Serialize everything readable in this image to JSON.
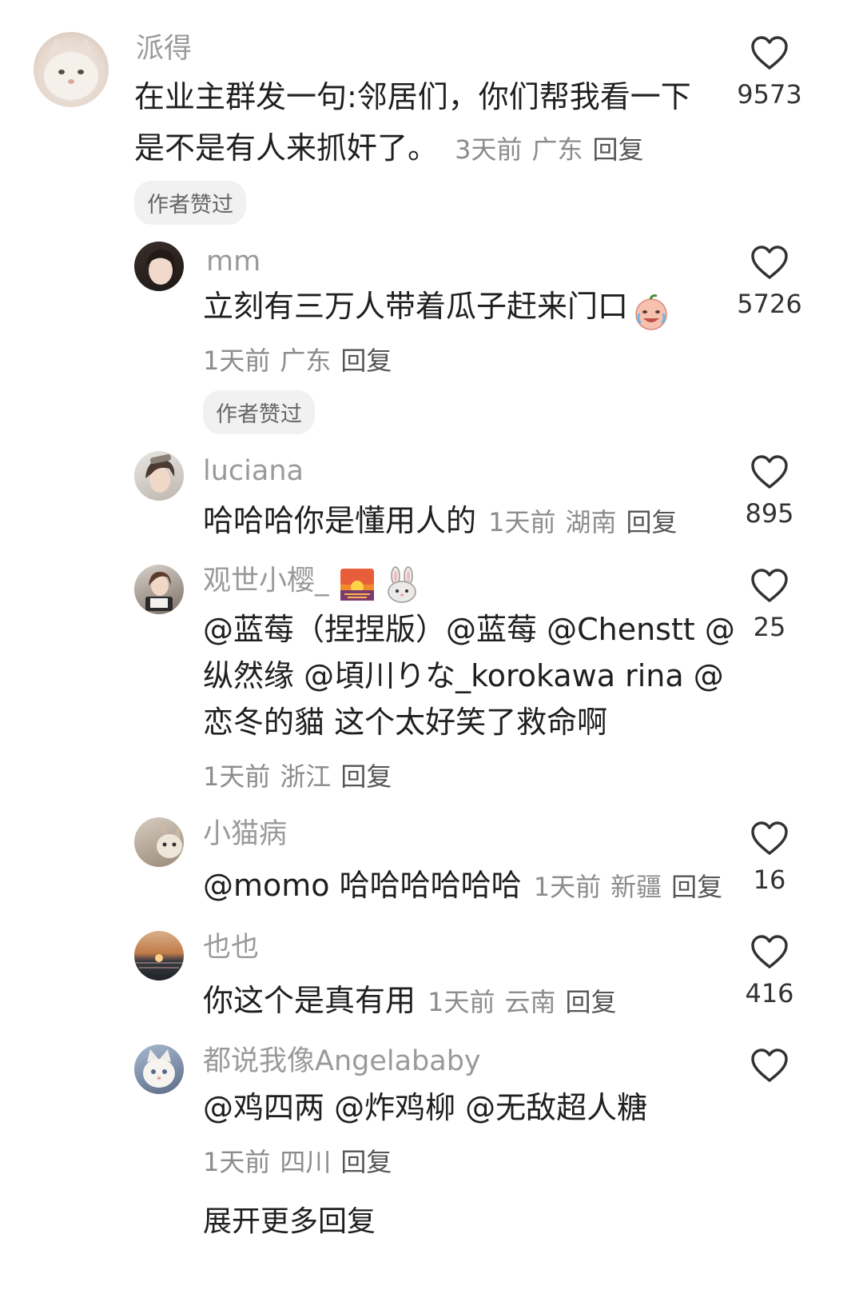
{
  "comments": [
    {
      "name": "派得",
      "text1": "在业主群发一句:邻居们，你们帮我看一下",
      "text2": "是不是有人来抓奸了。",
      "time": "3天前",
      "location": "广东",
      "reply": "回复",
      "likes": "9573",
      "badge": "作者赞过",
      "avatar_icon": "cat-avatar-icon"
    },
    {
      "name": "mm",
      "text": "立刻有三万人带着瓜子赶来门口",
      "time": "1天前",
      "location": "广东",
      "reply": "回复",
      "likes": "5726",
      "badge": "作者赞过",
      "avatar_icon": "girl-avatar-icon",
      "emoji_icon": "crying-laughing-emoji-icon"
    },
    {
      "name": "luciana",
      "text": "哈哈哈你是懂用人的",
      "time": "1天前",
      "location": "湖南",
      "reply": "回复",
      "likes": "895",
      "avatar_icon": "portrait-avatar-icon"
    },
    {
      "name": "观世小樱_",
      "text1": "@蓝莓（捏捏版）@蓝莓 @Chenstt @",
      "text2": "纵然缘 @頃川りな_korokawa rina @",
      "text3": "恋冬的貓 这个太好笑了救命啊",
      "time": "1天前",
      "location": "浙江",
      "reply": "回复",
      "likes": "25",
      "avatar_icon": "reading-girl-avatar-icon",
      "name_emojis": [
        "sunset-emoji-icon",
        "rabbit-emoji-icon"
      ]
    },
    {
      "name": "小猫病",
      "text": "@momo 哈哈哈哈哈哈",
      "time": "1天前",
      "location": "新疆",
      "reply": "回复",
      "likes": "16",
      "avatar_icon": "cat-avatar-icon"
    },
    {
      "name": "也也",
      "text": "你这个是真有用",
      "time": "1天前",
      "location": "云南",
      "reply": "回复",
      "likes": "416",
      "avatar_icon": "sunset-sea-avatar-icon"
    },
    {
      "name": "都说我像Angelababy",
      "text": "@鸡四两 @炸鸡柳 @无敌超人糖",
      "time": "1天前",
      "location": "四川",
      "reply": "回复",
      "likes": "",
      "avatar_icon": "white-cat-avatar-icon"
    }
  ],
  "expand_more": "展开更多回复",
  "colors": {
    "name": "#9a9a9a",
    "text": "#1f1f1f",
    "meta": "#8c8c8c",
    "badge_bg": "#f1f1f1"
  }
}
